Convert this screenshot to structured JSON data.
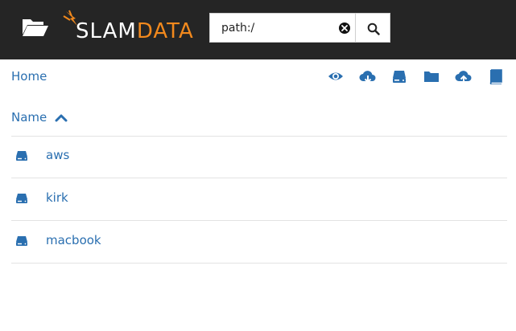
{
  "header": {
    "folder_icon": "folder-open-icon",
    "logo": {
      "part1": "SLAM",
      "part2": "DATA",
      "accent": "#f2891d"
    },
    "search": {
      "value": "path:/",
      "placeholder": ""
    },
    "clear_icon": "times-circle-icon",
    "search_icon": "search-icon"
  },
  "breadcrumb": {
    "label": "Home"
  },
  "toolbar": {
    "icons": [
      "eye-icon",
      "cloud-download-icon",
      "hdd-icon",
      "folder-icon",
      "cloud-upload-icon",
      "book-icon"
    ]
  },
  "list": {
    "sort_label": "Name",
    "sort_direction": "ascending",
    "items": [
      {
        "name": "aws",
        "icon": "hdd-icon"
      },
      {
        "name": "kirk",
        "icon": "hdd-icon"
      },
      {
        "name": "macbook",
        "icon": "hdd-icon"
      }
    ]
  },
  "colors": {
    "header_bg": "#252525",
    "link": "#2a6fb0",
    "divider": "#e3e3e3"
  }
}
